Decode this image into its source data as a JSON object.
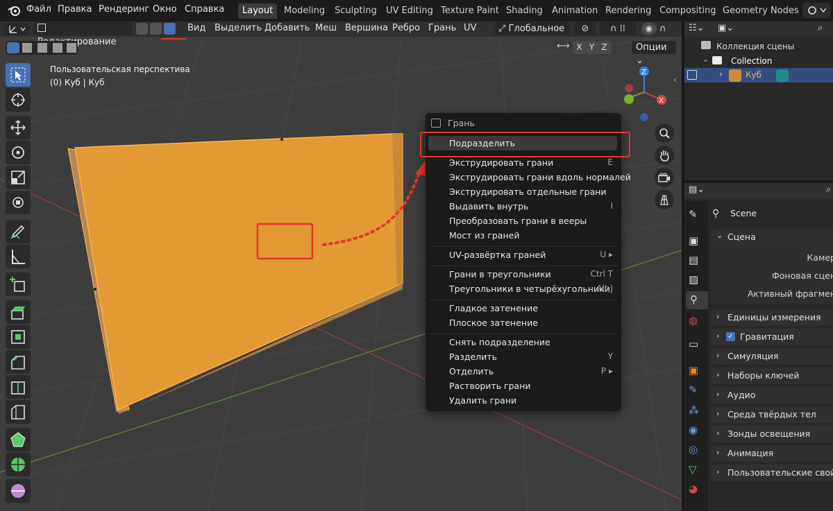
{
  "topbar": {
    "menus": [
      "Файл",
      "Правка",
      "Рендеринг",
      "Окно",
      "Справка"
    ],
    "workspaces": [
      "Layout",
      "Modeling",
      "Sculpting",
      "UV Editing",
      "Texture Paint",
      "Shading",
      "Animation",
      "Rendering",
      "Compositing",
      "Geometry Nodes"
    ],
    "active_workspace": "Layout"
  },
  "viewport_header": {
    "mode": "Редактирование",
    "menus": [
      "Вид",
      "Выделить",
      "Добавить",
      "Меш",
      "Вершина",
      "Ребро",
      "Грань",
      "UV"
    ],
    "orientation": "Глобальное",
    "axes": [
      "X",
      "Y",
      "Z"
    ],
    "options": "Опции"
  },
  "viewport_overlay": {
    "view_name": "Пользовательская перспектива",
    "object_info": "(0) Куб | Куб"
  },
  "context_menu": {
    "title": "Грань",
    "items": [
      {
        "label": "Подразделить",
        "shortcut": ""
      },
      {
        "label": "Экструдировать грани",
        "shortcut": "E"
      },
      {
        "label": "Экструдировать грани вдоль нормалей",
        "shortcut": ""
      },
      {
        "label": "Экструдировать отдельные грани",
        "shortcut": ""
      },
      {
        "label": "Выдавить внутрь",
        "shortcut": "I"
      },
      {
        "label": "Преобразовать грани в вееры",
        "shortcut": ""
      },
      {
        "label": "Мост из граней",
        "shortcut": ""
      },
      {
        "label": "UV-развёртка граней",
        "shortcut": "U ▸"
      },
      {
        "label": "Грани в треугольники",
        "shortcut": "Ctrl T"
      },
      {
        "label": "Треугольники в четырёхугольники",
        "shortcut": "Alt J"
      },
      {
        "label": "Гладкое затенение",
        "shortcut": ""
      },
      {
        "label": "Плоское затенение",
        "shortcut": ""
      },
      {
        "label": "Снять подразделение",
        "shortcut": ""
      },
      {
        "label": "Разделить",
        "shortcut": "Y"
      },
      {
        "label": "Отделить",
        "shortcut": "P ▸"
      },
      {
        "label": "Растворить грани",
        "shortcut": ""
      },
      {
        "label": "Удалить грани",
        "shortcut": ""
      }
    ]
  },
  "outliner": {
    "scene_collection": "Коллекция сцены",
    "collection": "Collection",
    "object": "Куб"
  },
  "properties": {
    "context": "Scene",
    "section_open": "Сцена",
    "fields": [
      "Камер",
      "Фоновая сцен",
      "Активный фрагмен"
    ],
    "sections": [
      "Единицы измерения",
      "Гравитация",
      "Симуляция",
      "Наборы ключей",
      "Аудио",
      "Среда твёрдых тел",
      "Зонды освещения",
      "Анимация",
      "Пользовательские свойств"
    ]
  },
  "colors": {
    "accent": "#4772b3",
    "mesh_face": "#e8982e",
    "highlight_box": "#e0372c",
    "viewport_bg": "#3d3d3d"
  }
}
